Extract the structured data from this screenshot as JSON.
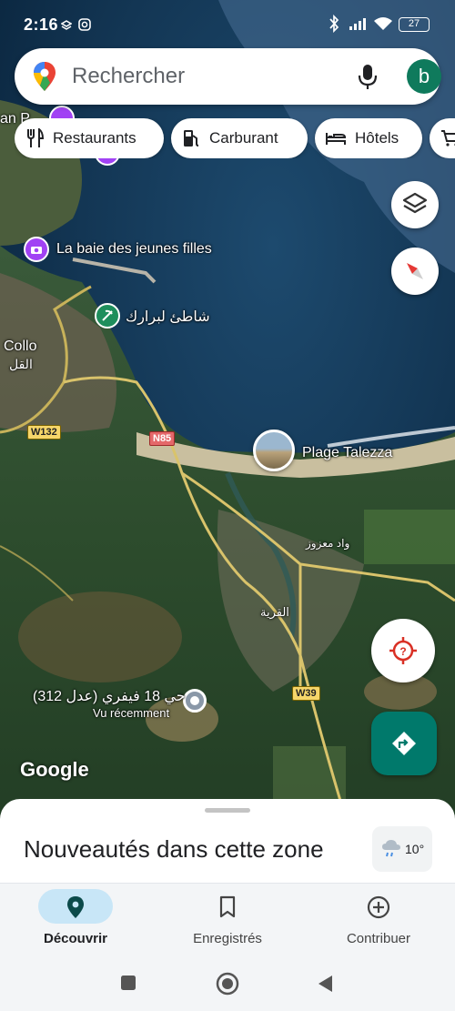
{
  "status": {
    "time": "2:16",
    "battery": "27"
  },
  "search": {
    "placeholder": "Rechercher",
    "avatar_letter": "b"
  },
  "chips": [
    {
      "label": "Restaurants",
      "icon": "fork-knife-icon"
    },
    {
      "label": "Carburant",
      "icon": "fuel-pump-icon"
    },
    {
      "label": "Hôtels",
      "icon": "bed-icon"
    },
    {
      "label": "",
      "icon": "cart-icon"
    }
  ],
  "map": {
    "labels": {
      "baie": "La baie des jeunes filles",
      "beach_ar": "شاطئ لبرارك",
      "collo": "Collo",
      "collo_ar": "القل",
      "plage": "Plage Talezza",
      "wad_ar": "واد معزوز",
      "village_ar": "القرية",
      "residence": "حي 18 فيفري (عدل 312)",
      "seen": "Vu récemment",
      "partial_left": "an P",
      "google": "Google"
    },
    "roads": {
      "w132": "W132",
      "n85": "N85",
      "w39": "W39"
    }
  },
  "sheet": {
    "title": "Nouveautés dans cette zone",
    "temperature": "10°"
  },
  "nav": {
    "discover": "Découvrir",
    "saved": "Enregistrés",
    "contribute": "Contribuer"
  },
  "colors": {
    "accent_teal": "#0f7a5c",
    "directions_fab": "#00796b",
    "active_pill": "#c8e6f7",
    "poi_purple": "#a142f4",
    "poi_green": "#1e8e5c"
  }
}
